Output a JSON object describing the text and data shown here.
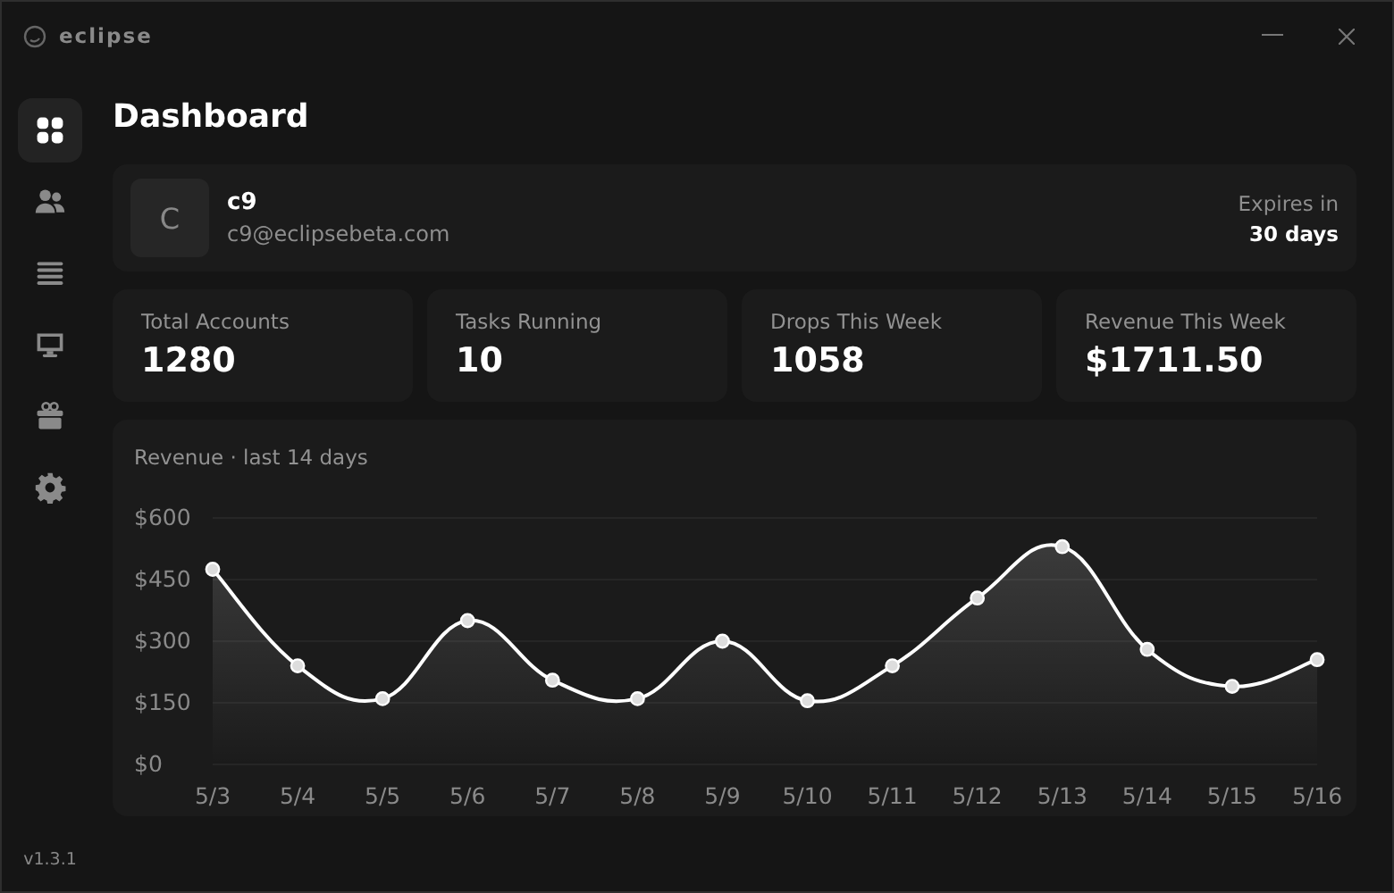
{
  "window": {
    "title": "eclipse"
  },
  "sidebar": {
    "items": [
      {
        "kind": "grid",
        "selected": true
      },
      {
        "kind": "users",
        "selected": false
      },
      {
        "kind": "list",
        "selected": false
      },
      {
        "kind": "monitor",
        "selected": false
      },
      {
        "kind": "gift",
        "selected": false
      },
      {
        "kind": "gear",
        "selected": false
      }
    ],
    "version": "v1.3.1"
  },
  "page": {
    "title": "Dashboard"
  },
  "user": {
    "avatar": "C",
    "name": "c9",
    "email": "c9@eclipsebeta.com",
    "expires_label": "Expires in",
    "expires_value": "30 days"
  },
  "stats": [
    {
      "label": "Total Accounts",
      "value": "1280"
    },
    {
      "label": "Tasks Running",
      "value": "10"
    },
    {
      "label": "Drops This Week",
      "value": "1058"
    },
    {
      "label": "Revenue This Week",
      "value": "$1711.50"
    }
  ],
  "revenue": {
    "title": "Revenue · last 14 days",
    "chart_data": {
      "type": "area",
      "categories": [
        "5/3",
        "5/4",
        "5/5",
        "5/6",
        "5/7",
        "5/8",
        "5/9",
        "5/10",
        "5/11",
        "5/12",
        "5/13",
        "5/14",
        "5/15",
        "5/16"
      ],
      "grid": true,
      "series": [
        {
          "color": "#ffffff",
          "values": [
            475,
            240,
            160,
            350,
            205,
            160,
            300,
            155,
            240,
            405,
            530,
            280,
            190,
            255
          ]
        }
      ],
      "ylim": [
        0,
        600
      ],
      "yticks": [
        {
          "value": 0,
          "label": "$0"
        },
        {
          "value": 150,
          "label": "$150"
        },
        {
          "value": 300,
          "label": "$300"
        },
        {
          "value": 450,
          "label": "$450"
        },
        {
          "value": 600,
          "label": "$600"
        }
      ]
    }
  }
}
